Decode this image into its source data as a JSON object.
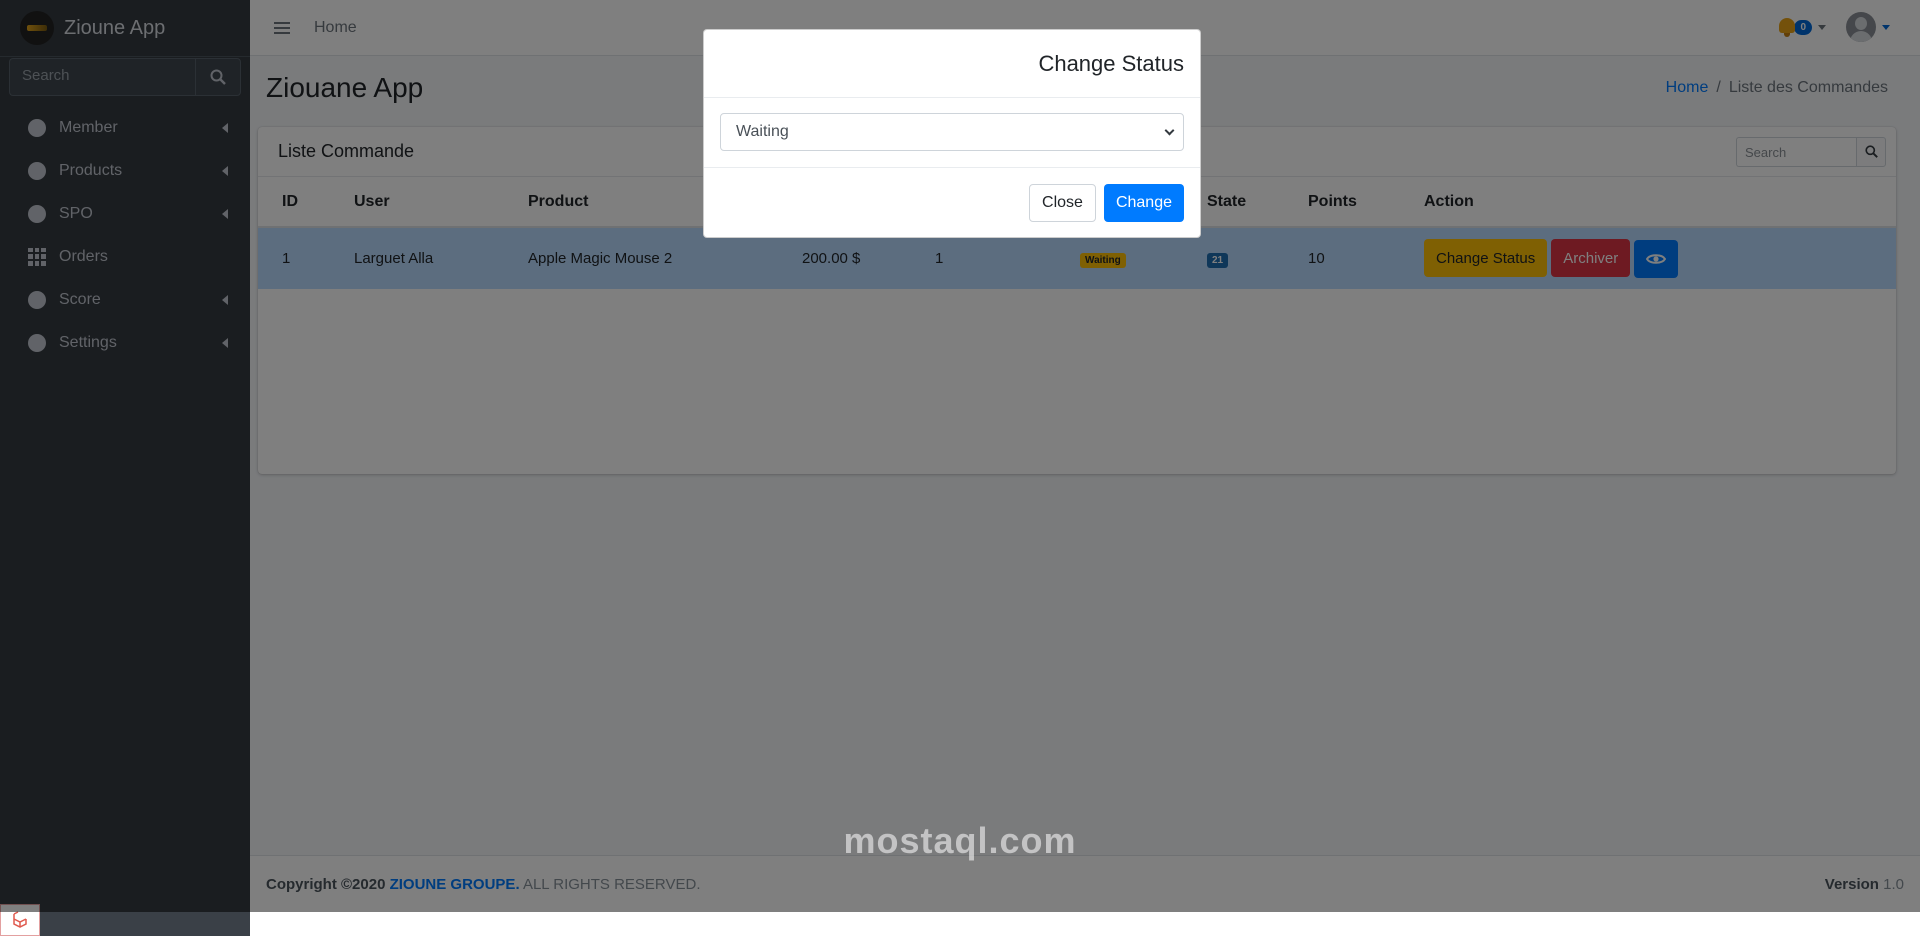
{
  "app": {
    "brand_name": "Zioune App",
    "search_placeholder": "Search"
  },
  "sidebar": {
    "items": [
      {
        "label": "Member",
        "icon": "circle-icon",
        "has_children": true
      },
      {
        "label": "Products",
        "icon": "circle-icon",
        "has_children": true
      },
      {
        "label": "SPO",
        "icon": "circle-icon",
        "has_children": true
      },
      {
        "label": "Orders",
        "icon": "grid-icon",
        "has_children": false
      },
      {
        "label": "Score",
        "icon": "circle-icon",
        "has_children": true
      },
      {
        "label": "Settings",
        "icon": "circle-icon",
        "has_children": true
      }
    ]
  },
  "topbar": {
    "home_link": "Home",
    "notification_count": "0"
  },
  "page": {
    "title": "Ziouane App",
    "breadcrumb": {
      "home": "Home",
      "current": "Liste des Commandes"
    }
  },
  "card": {
    "title": "Liste Commande",
    "search_placeholder": "Search",
    "columns": [
      "ID",
      "User",
      "Product",
      "",
      "",
      "",
      "State",
      "Points",
      "Action"
    ],
    "rows": [
      {
        "id": "1",
        "user": "Larguet Alla",
        "product": "Apple Magic Mouse 2",
        "price": "200.00 $",
        "quantity": "1",
        "status": "Waiting",
        "state": "21",
        "points": "10",
        "actions": {
          "change_status": "Change Status",
          "archive": "Archiver"
        }
      }
    ]
  },
  "footer": {
    "copyright_prefix": "Copyright ©2020",
    "company": "ZIOUNE GROUPE.",
    "rights": "ALL RIGHTS RESERVED.",
    "version_label": "Version",
    "version_number": "1.0"
  },
  "modal": {
    "title": "Change Status",
    "selected_option": "Waiting",
    "close_label": "Close",
    "change_label": "Change"
  },
  "watermark": {
    "text": "mostaql.com"
  },
  "colors": {
    "sidebar_bg": "#343a40",
    "primary": "#007bff",
    "warning": "#ffc107",
    "danger": "#dc3545",
    "selected_row": "#b8daff"
  }
}
